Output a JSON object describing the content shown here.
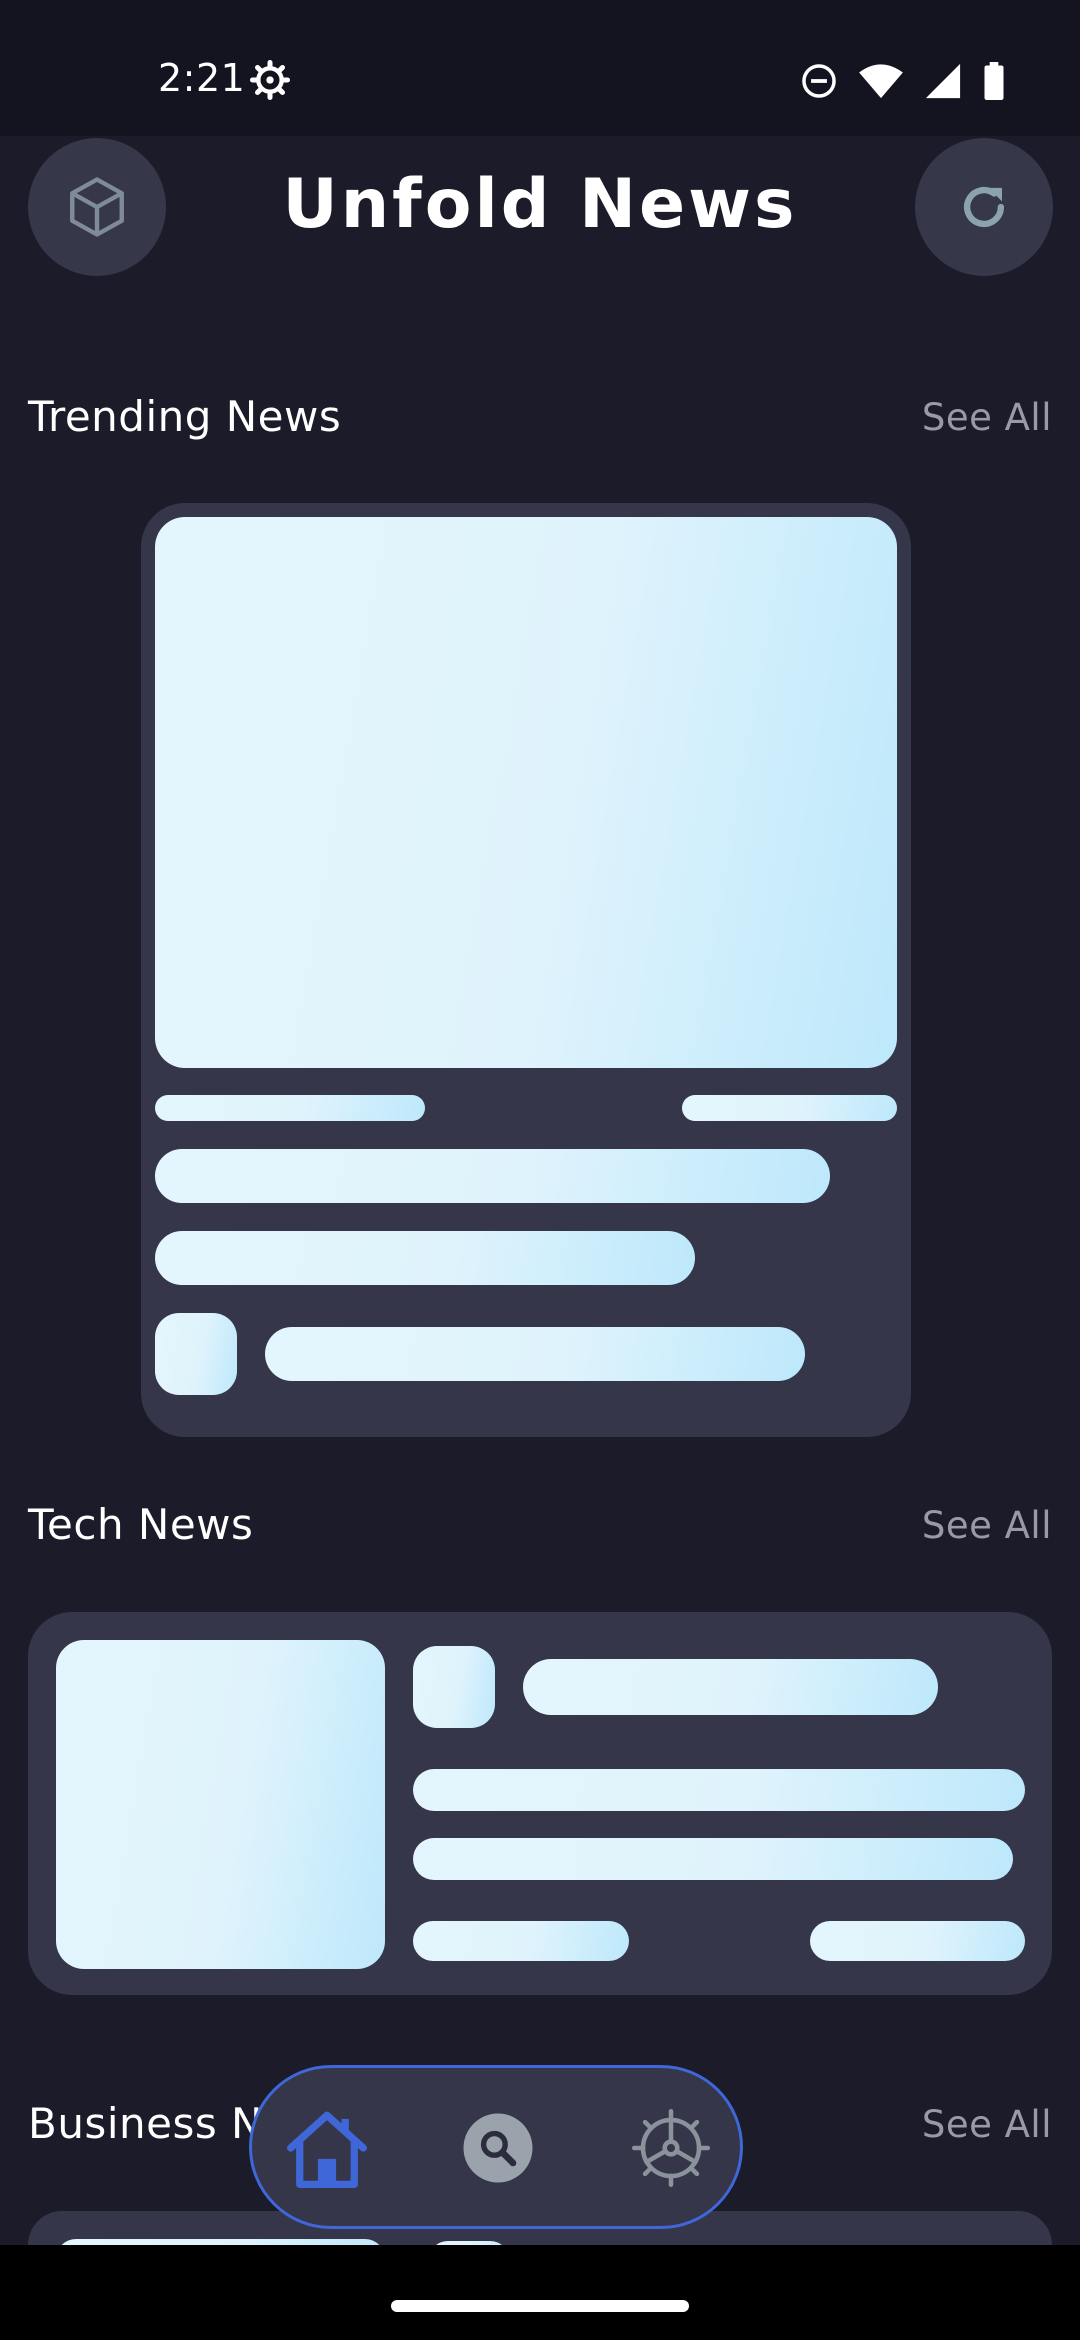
{
  "status_bar": {
    "time": "2:21",
    "icons": [
      "settings-gear-icon",
      "do-not-disturb-icon",
      "wifi-icon",
      "cellular-signal-icon",
      "battery-icon"
    ]
  },
  "header": {
    "title": "Unfold News",
    "left_icon": "cube-icon",
    "right_icon": "refresh-icon"
  },
  "sections": [
    {
      "title": "Trending News",
      "see_all": "See All"
    },
    {
      "title": "Tech News",
      "see_all": "See All"
    },
    {
      "title": "Business N",
      "see_all": "See All"
    }
  ],
  "bottom_nav": {
    "items": [
      "home-icon",
      "search-icon",
      "settings-icon"
    ],
    "active": "home-icon"
  },
  "colors": {
    "background": "#1b1b29",
    "card": "#35364a",
    "skeleton_light": "#e4f6fd",
    "skeleton_accent": "#bde8fb",
    "nav_accent": "#3f67d8",
    "muted_text": "#9a9aa6"
  }
}
